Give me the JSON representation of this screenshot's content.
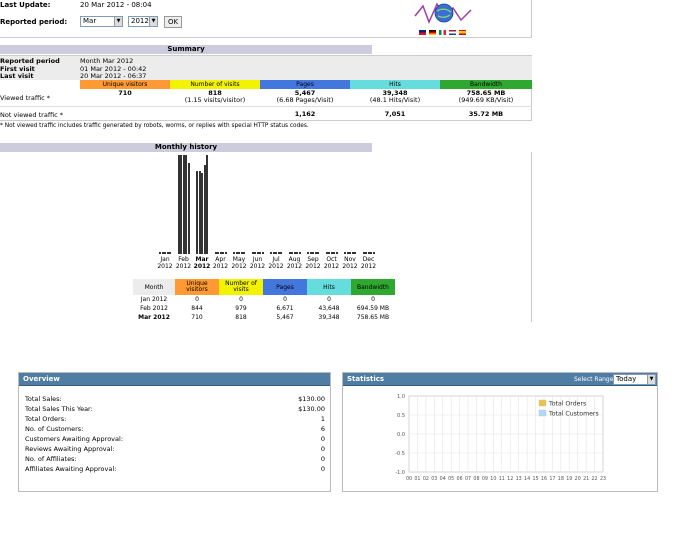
{
  "header": {
    "last_update_label": "Last Update:",
    "last_update_value": "20 Mar 2012 - 08:04",
    "reported_period_label": "Reported period:",
    "month_select": "Mar",
    "year_select": "2012",
    "ok_label": "OK"
  },
  "summary": {
    "title": "Summary",
    "rows_left": [
      {
        "label": "Reported period",
        "value": "Month Mar 2012"
      },
      {
        "label": "First visit",
        "value": "01 Mar 2012 - 00:42"
      },
      {
        "label": "Last visit",
        "value": "20 Mar 2012 - 06:37"
      }
    ],
    "col_headers": [
      "Unique visitors",
      "Number of visits",
      "Pages",
      "Hits",
      "Bandwidth"
    ],
    "viewed_label": "Viewed traffic *",
    "viewed": [
      "710",
      "818",
      "5,467",
      "39,348",
      "758.65 MB"
    ],
    "viewed_sub": [
      "",
      "(1.15 visits/visitor)",
      "(6.68 Pages/Visit)",
      "(48.1 Hits/Visit)",
      "(949.69 KB/Visit)"
    ],
    "not_viewed_label": "Not viewed traffic *",
    "not_viewed": [
      "",
      "",
      "1,162",
      "7,051",
      "35.72 MB"
    ],
    "footnote": "* Not viewed traffic includes traffic generated by robots, worms, or replies with special HTTP status codes."
  },
  "history": {
    "title": "Monthly history",
    "months": [
      "Jan",
      "Feb",
      "Mar",
      "Apr",
      "May",
      "Jun",
      "Jul",
      "Aug",
      "Sep",
      "Oct",
      "Nov",
      "Dec"
    ],
    "year": "2012",
    "table_headers": [
      "Month",
      "Unique visitors",
      "Number of visits",
      "Pages",
      "Hits",
      "Bandwidth"
    ],
    "table_rows": [
      [
        "Jan 2012",
        "0",
        "0",
        "0",
        "0",
        "0"
      ],
      [
        "Feb 2012",
        "844",
        "979",
        "6,671",
        "43,648",
        "694.59 MB"
      ],
      [
        "Mar 2012",
        "710",
        "818",
        "5,467",
        "39,348",
        "758.65 MB"
      ]
    ]
  },
  "overview": {
    "title": "Overview",
    "rows": [
      {
        "label": "Total Sales:",
        "value": "$130.00"
      },
      {
        "label": "Total Sales This Year:",
        "value": "$130.00"
      },
      {
        "label": "Total Orders:",
        "value": "1"
      },
      {
        "label": "No. of Customers:",
        "value": "6"
      },
      {
        "label": "Customers Awaiting Approval:",
        "value": "0"
      },
      {
        "label": "Reviews Awaiting Approval:",
        "value": "0"
      },
      {
        "label": "No. of Affiliates:",
        "value": "0"
      },
      {
        "label": "Affiliates Awaiting Approval:",
        "value": "0"
      }
    ]
  },
  "statistics": {
    "title": "Statistics",
    "range_label": "Select Range:",
    "range_value": "Today",
    "y_ticks": [
      "1.0",
      "0.5",
      "0.0",
      "-0.5",
      "-1.0"
    ],
    "x_ticks": [
      "00",
      "01",
      "02",
      "03",
      "04",
      "05",
      "06",
      "07",
      "08",
      "09",
      "10",
      "11",
      "12",
      "13",
      "14",
      "15",
      "16",
      "17",
      "18",
      "19",
      "20",
      "21",
      "22",
      "23"
    ],
    "legend": [
      "Total Orders",
      "Total Customers"
    ],
    "colors": {
      "orders": "#edc240",
      "customers": "#afd8f8"
    }
  }
}
